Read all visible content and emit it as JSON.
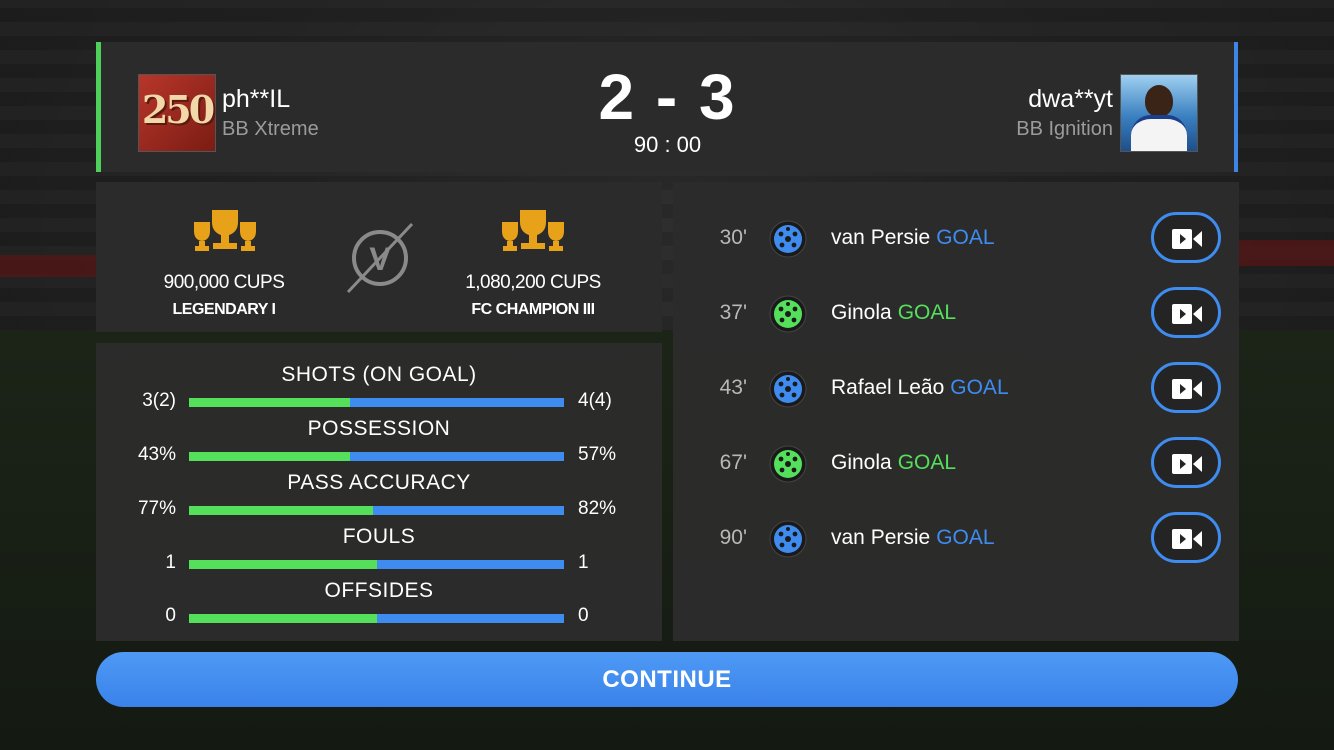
{
  "colors": {
    "home": "#55e05c",
    "away": "#3f8cf0",
    "gold": "#e8a21a"
  },
  "header": {
    "left": {
      "name": "ph**IL",
      "team": "BB Xtreme",
      "badge": "250"
    },
    "right": {
      "name": "dwa**yt",
      "team": "BB Ignition"
    },
    "score": "2 - 3",
    "clock": "90 : 00"
  },
  "cups": {
    "left": {
      "value": "900,000 CUPS",
      "rank": "LEGENDARY I",
      "icon": "trophy-icon"
    },
    "right": {
      "value": "1,080,200 CUPS",
      "rank": "FC CHAMPION III",
      "icon": "trophy-icon"
    },
    "vs_icon": "versus-icon",
    "vs_letter": "V"
  },
  "stats": [
    {
      "title": "SHOTS (ON GOAL)",
      "left": "3(2)",
      "right": "4(4)",
      "share": 0.43
    },
    {
      "title": "POSSESSION",
      "left": "43%",
      "right": "57%",
      "share": 0.43
    },
    {
      "title": "PASS ACCURACY",
      "left": "77%",
      "right": "82%",
      "share": 0.49
    },
    {
      "title": "FOULS",
      "left": "1",
      "right": "1",
      "share": 0.5
    },
    {
      "title": "OFFSIDES",
      "left": "0",
      "right": "0",
      "share": 0.5
    }
  ],
  "events": [
    {
      "time": "30'",
      "player": "van Persie",
      "type": "GOAL",
      "side": "away"
    },
    {
      "time": "37'",
      "player": "Ginola",
      "type": "GOAL",
      "side": "home"
    },
    {
      "time": "43'",
      "player": "Rafael Leão",
      "type": "GOAL",
      "side": "away"
    },
    {
      "time": "67'",
      "player": "Ginola",
      "type": "GOAL",
      "side": "home"
    },
    {
      "time": "90'",
      "player": "van Persie",
      "type": "GOAL",
      "side": "away"
    }
  ],
  "continue_label": "CONTINUE"
}
